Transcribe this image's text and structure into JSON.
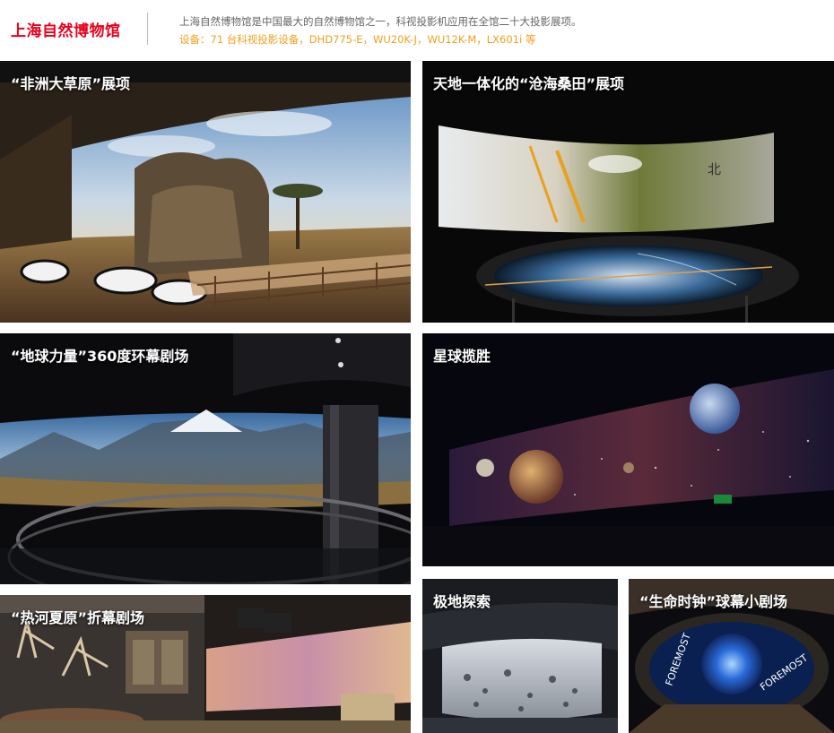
{
  "header": {
    "title": "上海自然博物馆",
    "description": "上海自然博物馆是中国最大的自然博物馆之一，科视投影机应用在全馆二十大投影展项。",
    "equipment": "设备：71 台科视投影设备，DHD775-E，WU20K-J，WU12K-M，LX601i 等"
  },
  "tiles": [
    {
      "caption": "“非洲大草原”展项"
    },
    {
      "caption": "天地一体化的“沧海桑田”展项"
    },
    {
      "caption": "“地球力量”360度环幕剧场"
    },
    {
      "caption": "星球揽胜"
    },
    {
      "caption": "“热河夏原”折幕剧场"
    },
    {
      "caption": "极地探索"
    },
    {
      "caption": "“生命时钟”球幕小剧场"
    }
  ],
  "scene_text": {
    "north_mark": "北",
    "dome_text_left": "FOREMOST",
    "dome_text_right": "FOREMOST"
  },
  "colors": {
    "title_red": "#e8001c",
    "equipment_orange": "#f0a020",
    "description_gray": "#666666"
  }
}
